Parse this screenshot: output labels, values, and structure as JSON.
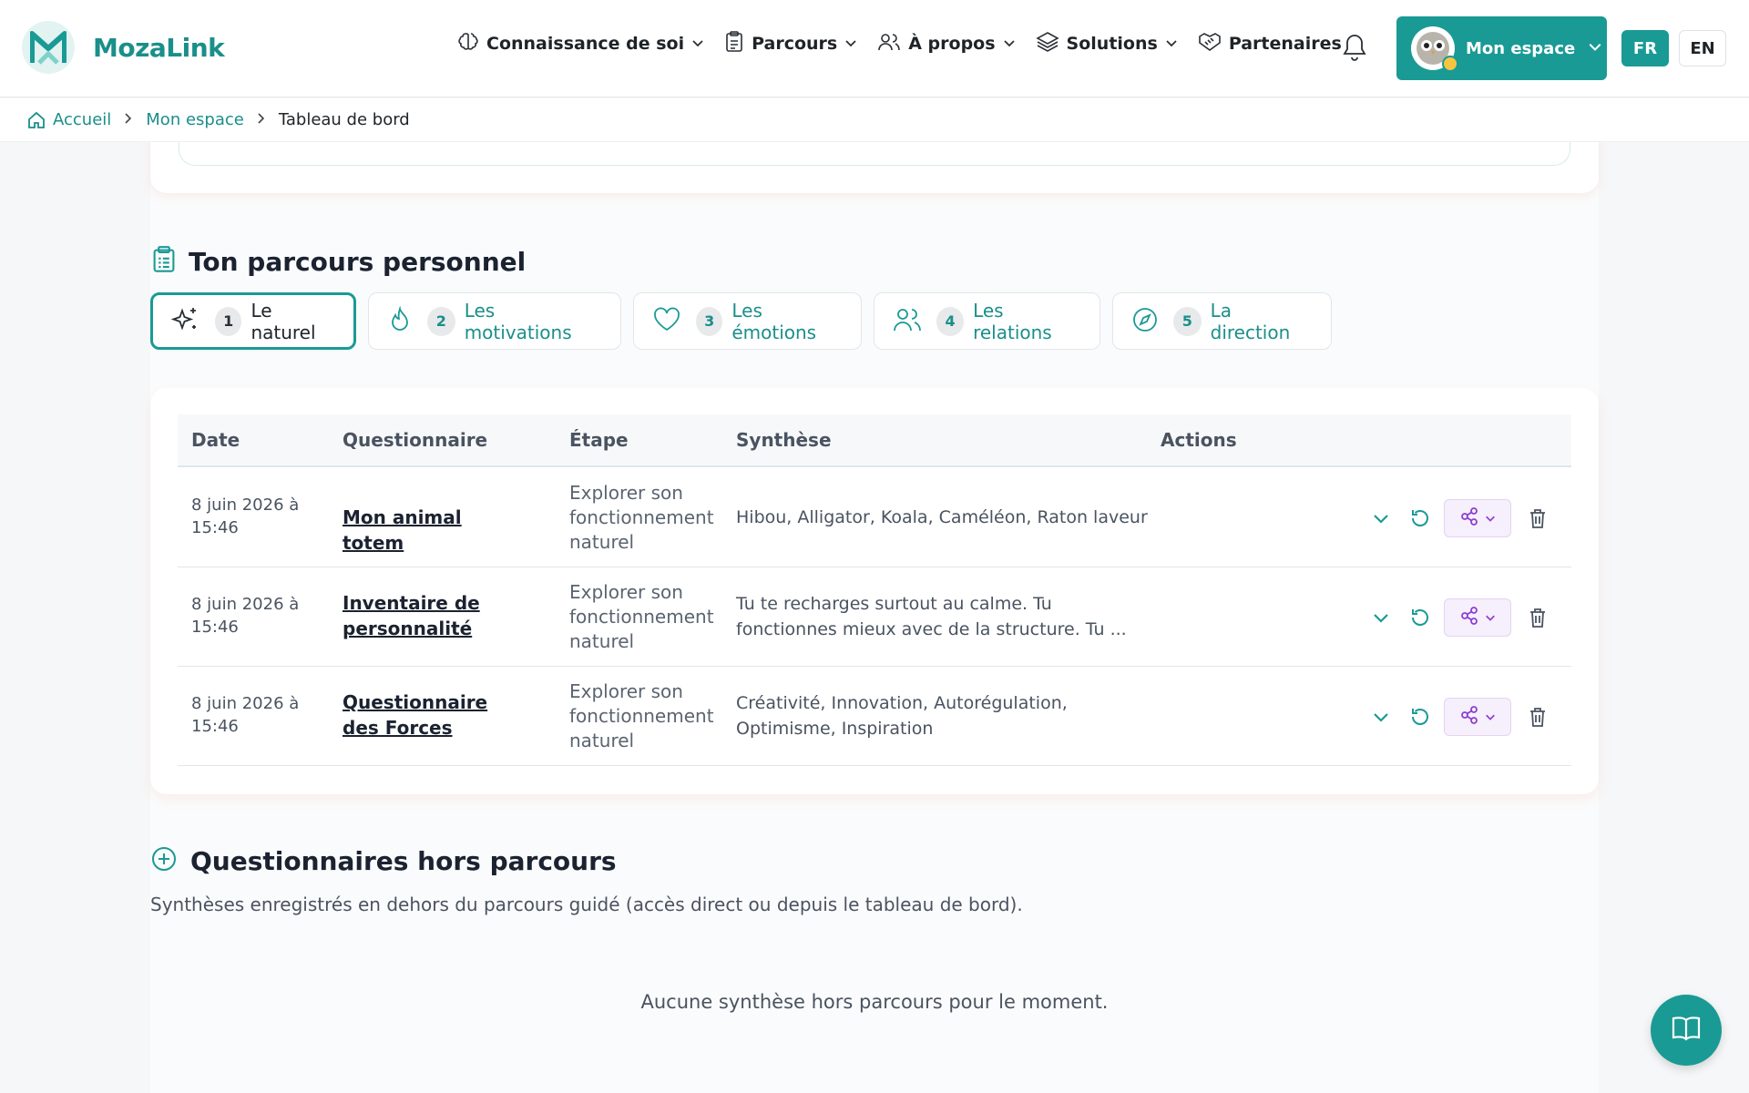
{
  "brand": {
    "name": "MozaLink",
    "color": "#1a9a94"
  },
  "nav": {
    "items": [
      {
        "label": "Connaissance de soi",
        "icon": "brain-icon",
        "has_dropdown": true
      },
      {
        "label": "Parcours",
        "icon": "clipboard-icon",
        "has_dropdown": true
      },
      {
        "label": "À propos",
        "icon": "users-icon",
        "has_dropdown": true
      },
      {
        "label": "Solutions",
        "icon": "layers-icon",
        "has_dropdown": true
      },
      {
        "label": "Partenaires",
        "icon": "handshake-icon",
        "has_dropdown": false
      }
    ],
    "account_label": "Mon espace",
    "lang_fr": "FR",
    "lang_en": "EN",
    "active_lang": "FR"
  },
  "breadcrumb": {
    "items": [
      "Accueil",
      "Mon espace"
    ],
    "current": "Tableau de bord"
  },
  "journey": {
    "title": "Ton parcours personnel",
    "tabs": [
      {
        "num": "1",
        "label": "Le naturel",
        "icon": "sparkles-icon",
        "active": true
      },
      {
        "num": "2",
        "label": "Les motivations",
        "icon": "flame-icon",
        "active": false
      },
      {
        "num": "3",
        "label": "Les émotions",
        "icon": "heart-icon",
        "active": false
      },
      {
        "num": "4",
        "label": "Les relations",
        "icon": "users-icon",
        "active": false
      },
      {
        "num": "5",
        "label": "La direction",
        "icon": "compass-icon",
        "active": false
      }
    ],
    "table": {
      "headers": {
        "date": "Date",
        "questionnaire": "Questionnaire",
        "step": "Étape",
        "synthesis": "Synthèse",
        "actions": "Actions"
      },
      "rows": [
        {
          "date": "8 juin 2026 à 15:46",
          "questionnaire": "Mon animal totem",
          "step": "Explorer son fonctionnement naturel",
          "synthesis": "Hibou, Alligator, Koala, Caméléon, Raton laveur"
        },
        {
          "date": "8 juin 2026 à 15:46",
          "questionnaire": "Inventaire de personnalité",
          "step": "Explorer son fonctionnement naturel",
          "synthesis": "Tu te recharges surtout au calme. Tu fonctionnes mieux avec de la structure. Tu ..."
        },
        {
          "date": "8 juin 2026 à 15:46",
          "questionnaire": "Questionnaire des Forces",
          "step": "Explorer son fonctionnement naturel",
          "synthesis": "Créativité, Innovation, Autorégulation, Optimisme, Inspiration"
        }
      ]
    }
  },
  "outside": {
    "title": "Questionnaires hors parcours",
    "description": "Synthèses enregistrés en dehors du parcours guidé (accès direct ou depuis le tableau de bord).",
    "empty": "Aucune synthèse hors parcours pour le moment."
  }
}
